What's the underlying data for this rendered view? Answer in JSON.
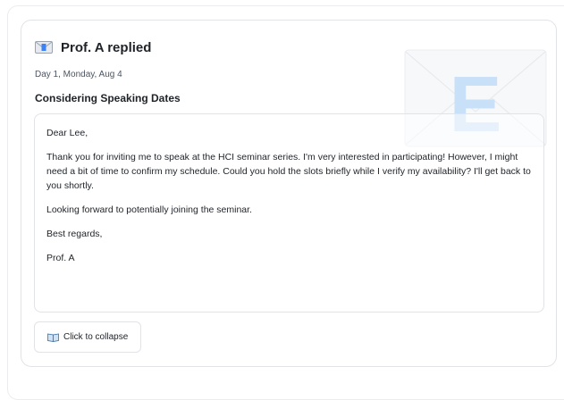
{
  "reply": {
    "title": "Prof. A replied",
    "date": "Day 1, Monday, Aug 4",
    "subject": "Considering Speaking Dates",
    "icon": "incoming-envelope-icon",
    "background_icon": "envelope-letter-e-icon",
    "background_letter": "E"
  },
  "letter": {
    "greeting": "Dear Lee,",
    "paragraph1": "Thank you for inviting me to speak at the HCI seminar series. I'm very interested in participating! However, I might need a bit of time to confirm my schedule. Could you hold the slots briefly while I verify my availability? I'll get back to you shortly.",
    "paragraph2": "Looking forward to potentially joining the seminar.",
    "closing": "Best regards,",
    "signature": "Prof. A"
  },
  "actions": {
    "collapse_label": "Click to collapse",
    "collapse_icon": "open-book-icon"
  },
  "colors": {
    "accent_blue": "#9cc6f2",
    "border": "#e2e3e6",
    "text": "#1f2328"
  }
}
